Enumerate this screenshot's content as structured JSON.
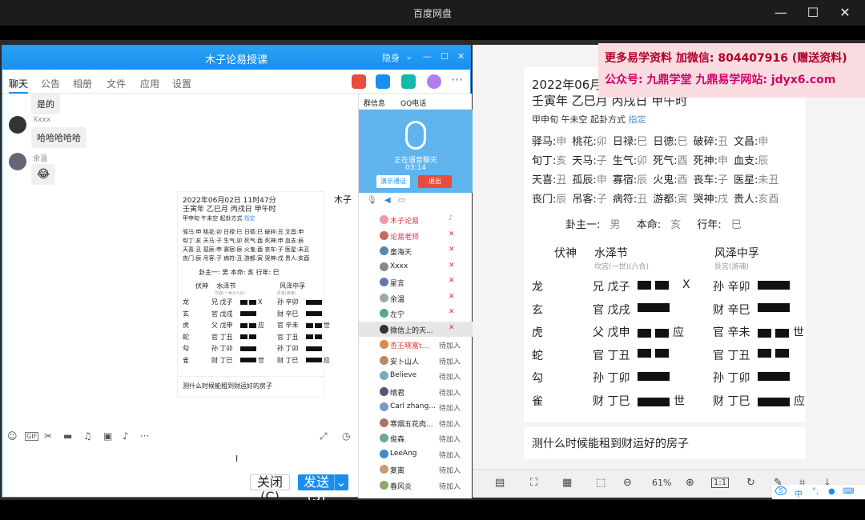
{
  "app_title": "百度网盘",
  "qq": {
    "title": "木子论易授课",
    "header_ctl": "隐身",
    "tabs": [
      "聊天",
      "公告",
      "相册",
      "文件",
      "应用",
      "设置"
    ],
    "messages": [
      {
        "text": "是的"
      },
      {
        "nick": "Xxxx",
        "text": "哈哈哈哈哈"
      },
      {
        "nick": "余温",
        "text": "😂"
      }
    ],
    "shared_card": {
      "header": "2022年06月02日 11时47分",
      "ganzhi": "壬寅年 乙巳月 丙戌日 甲午时",
      "sub": "甲申旬 午未空 起卦方式",
      "sub_link": "指定",
      "shensha": [
        "驿马:申 桃花:卯 日禄:巳 日德:巳 破碎:丑 文昌:申",
        "旬丁:亥 天马:子 生气:卯 死气:酉 死神:申 血支:辰",
        "天喜:丑 孤辰:申 寡宿:辰 火鬼:酉 丧车:子 医星:未丑",
        "丧门:辰 吊客:子 病符:丑 游都:寅 哭神:戌 贵人:亥酉"
      ],
      "info": "卦主一: 男  本命: 亥  行年: 巳",
      "gua_header": [
        "伏神",
        "水泽节",
        "风泽中孚"
      ],
      "gua_sub": [
        "坎宫(一世)(六合)",
        "艮宫(游魂)"
      ],
      "rows": [
        {
          "god": "龙",
          "left": "兄 戊子",
          "mark": "X",
          "right": "孙 辛卯"
        },
        {
          "god": "玄",
          "left": "官 戊戌",
          "mark": "",
          "right": "财 辛巳"
        },
        {
          "god": "虎",
          "left": "父 戊申",
          "mark": "应",
          "right": "官 辛未"
        },
        {
          "god": "蛇",
          "left": "官 丁丑",
          "mark": "",
          "right": "官 丁丑"
        },
        {
          "god": "勾",
          "left": "孙 丁卯",
          "mark": "",
          "right": "孙 丁卯"
        },
        {
          "god": "雀",
          "left": "财 丁巳",
          "mark": "世",
          "right": "财 丁巳"
        }
      ],
      "right_marks": [
        "",
        "",
        "世",
        "",
        "",
        "应"
      ],
      "question": "测什么时候能租到财运好的房子"
    },
    "side_char": "木子",
    "close_label": "关闭(C)",
    "send_label": "发送(S)",
    "voice": {
      "tabs": [
        "群信息",
        "QQ电话"
      ],
      "status": "正在语音聊天",
      "time": "03:14",
      "btn_demo": "演示通话",
      "btn_exit": "退出",
      "members": [
        {
          "name": "木子论易",
          "status": ""
        },
        {
          "name": "论易老师",
          "status": ""
        },
        {
          "name": "童海天",
          "status": ""
        },
        {
          "name": "Xxxx",
          "status": ""
        },
        {
          "name": "星言",
          "status": ""
        },
        {
          "name": "余温",
          "status": ""
        },
        {
          "name": "左宁",
          "status": ""
        },
        {
          "name": "微信上的天...",
          "status": ""
        },
        {
          "name": "杏王晓富t...",
          "status": "待加入"
        },
        {
          "name": "安卜山人",
          "status": "待加入"
        },
        {
          "name": "Believe",
          "status": "待加入"
        },
        {
          "name": "晴君",
          "status": "待加入"
        },
        {
          "name": "Carl zhang...",
          "status": "待加入"
        },
        {
          "name": "寒烟五花肉...",
          "status": "待加入"
        },
        {
          "name": "俊森",
          "status": "待加入"
        },
        {
          "name": "LeeAng",
          "status": "待加入"
        },
        {
          "name": "复离",
          "status": "待加入"
        },
        {
          "name": "春风炎",
          "status": "待加入"
        }
      ]
    }
  },
  "doc": {
    "header": "2022年06月",
    "ganzhi": "壬寅年 乙巳月 丙戌日 甲午时",
    "sub": "甲申旬 午未空 起卦方式",
    "sub_link": "指定",
    "shensha": [
      [
        "驿马:",
        "申",
        "桃花:",
        "卯",
        "日禄:",
        "巳",
        "日德:",
        "巳",
        "破碎:",
        "丑",
        "文昌:",
        "申"
      ],
      [
        "旬丁:",
        "亥",
        "天马:",
        "子",
        "生气:",
        "卯",
        "死气:",
        "酉",
        "死神:",
        "申",
        "血支:",
        "辰"
      ],
      [
        "天喜:",
        "丑",
        "孤辰:",
        "申",
        "寡宿:",
        "辰",
        "火鬼:",
        "酉",
        "丧车:",
        "子",
        "医星:",
        "未丑"
      ],
      [
        "丧门:",
        "辰",
        "吊客:",
        "子",
        "病符:",
        "丑",
        "游都:",
        "寅",
        "哭神:",
        "戌",
        "贵人:",
        "亥酉"
      ]
    ],
    "info_labels": [
      "卦主一:",
      "本命:",
      "行年:"
    ],
    "info_values": [
      "男",
      "亥",
      "巳"
    ],
    "fushen": "伏神",
    "gua_left": "水泽节",
    "gua_left_sub": "坎宫(一世)(六合)",
    "gua_right": "风泽中孚",
    "gua_right_sub": "艮宫(游魂)",
    "question": "测什么时候能租到财运好的房子",
    "zoom": "61%"
  },
  "promo": {
    "line1": "更多易学资料 加微信: 804407916 (赠送资料)",
    "line2": "公众号: 九鼎学堂 九鼎易学网站: jdyx6.com"
  },
  "ime": "中"
}
